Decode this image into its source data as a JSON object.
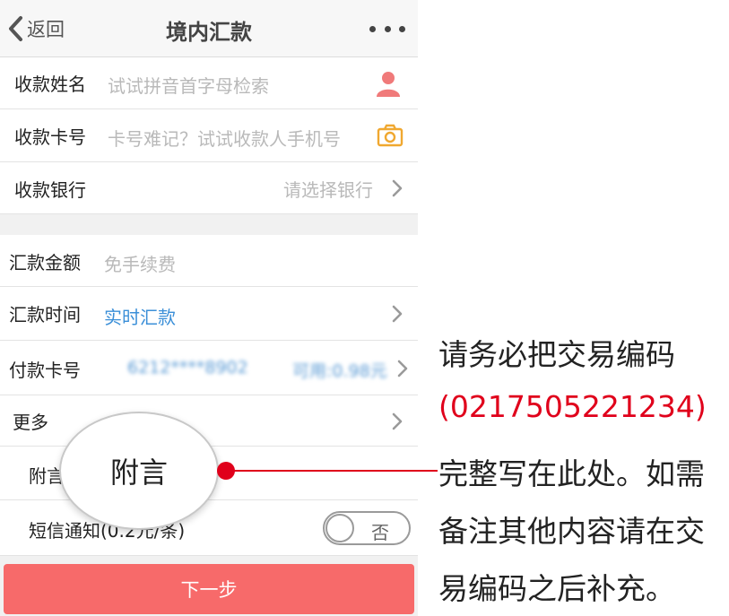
{
  "nav": {
    "back_label": "返回",
    "title": "境内汇款"
  },
  "section1": {
    "payee_name": {
      "label": "收款姓名",
      "placeholder": "试试拼音首字母检索"
    },
    "payee_card": {
      "label": "收款卡号",
      "placeholder": "卡号难记？试试收款人手机号"
    },
    "payee_bank": {
      "label": "收款银行",
      "placeholder": "请选择银行"
    }
  },
  "section2": {
    "amount": {
      "label": "汇款金额",
      "placeholder": "免手续费"
    },
    "time": {
      "label": "汇款时间",
      "value": "实时汇款"
    },
    "payer_card": {
      "label": "付款卡号",
      "card": "6212****8902",
      "balance": "可用:0.98元"
    },
    "more": {
      "label": "更多"
    },
    "remark": {
      "label": "附言"
    },
    "sms": {
      "label": "短信通知(0.2元/条)",
      "toggle_label": "否"
    }
  },
  "next_button": "下一步",
  "callout": {
    "bubble_label": "附言"
  },
  "instruction": {
    "line1": "请务必把交易编码",
    "line2": "(02175052212​34)",
    "line3": "完整写在此处。如需",
    "line4": "备注其他内容请在交",
    "line5": "易编码之后补充。"
  },
  "colors": {
    "accent_red": "#e0001b",
    "button": "#f76a6a",
    "link_blue": "#3b8fd8",
    "contact_icon": "#f07a7a",
    "camera_icon": "#f0a830"
  }
}
